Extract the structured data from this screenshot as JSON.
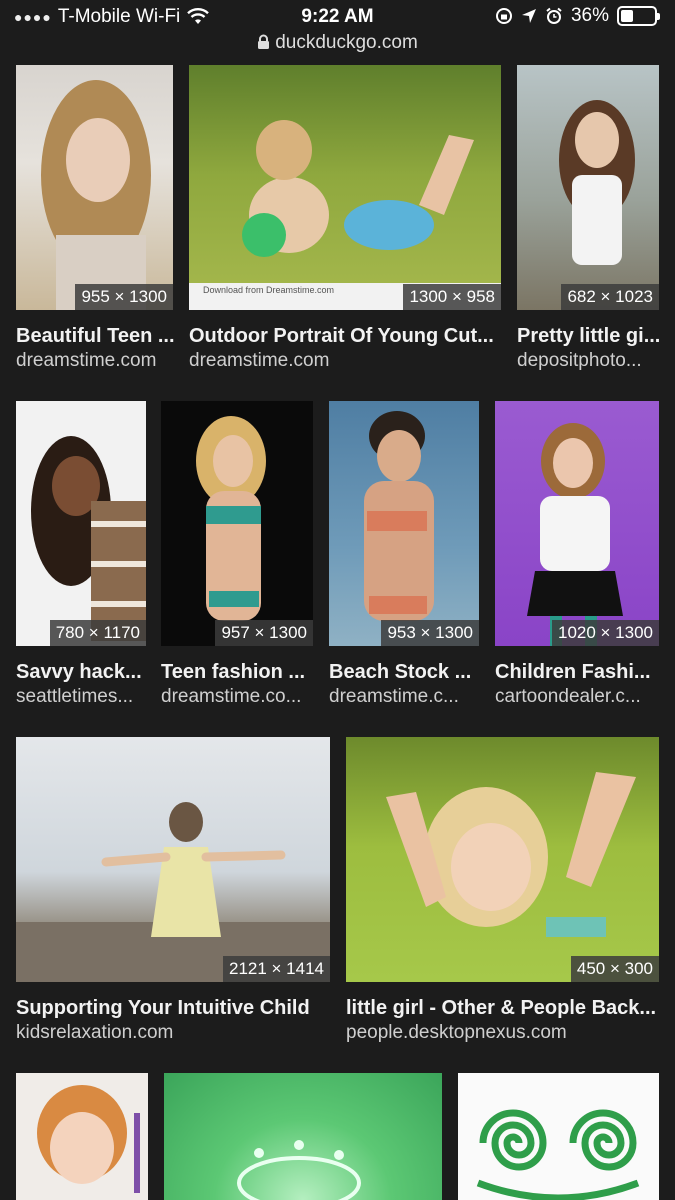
{
  "status_bar": {
    "carrier": "T-Mobile Wi-Fi",
    "time": "9:22 AM",
    "battery": "36%",
    "battery_level": 0.36
  },
  "url_bar": {
    "domain": "duckduckgo.com"
  },
  "results": [
    {
      "title": "Beautiful Teen ...",
      "source": "dreamstime.com",
      "dimensions": "955 × 1300"
    },
    {
      "title": "Outdoor Portrait Of Young Cut...",
      "source": "dreamstime.com",
      "dimensions": "1300 × 958",
      "watermark": "Download from Dreamstime.com"
    },
    {
      "title": "Pretty little gi...",
      "source": "depositphoto...",
      "dimensions": "682 × 1023"
    },
    {
      "title": "Savvy hack...",
      "source": "seattletimes...",
      "dimensions": "780 × 1170"
    },
    {
      "title": "Teen fashion ...",
      "source": "dreamstime.co...",
      "dimensions": "957 × 1300"
    },
    {
      "title": "Beach Stock ...",
      "source": "dreamstime.c...",
      "dimensions": "953 × 1300"
    },
    {
      "title": "Children Fashi...",
      "source": "cartoondealer.c...",
      "dimensions": "1020 × 1300"
    },
    {
      "title": "Supporting Your Intuitive Child",
      "source": "kidsrelaxation.com",
      "dimensions": "2121 × 1414"
    },
    {
      "title": "little girl - Other & People Back...",
      "source": "people.desktopnexus.com",
      "dimensions": "450 × 300"
    }
  ]
}
